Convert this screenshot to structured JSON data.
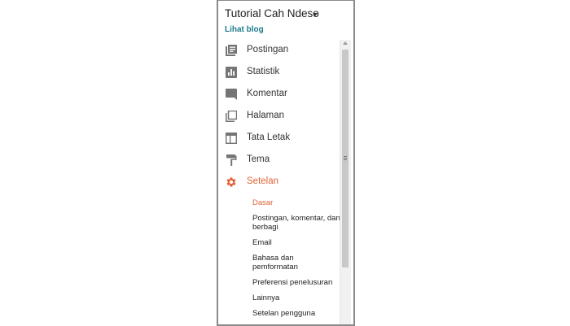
{
  "header": {
    "blog_title": "Tutorial Cah Ndeso",
    "view_blog_link": "Lihat blog"
  },
  "nav": {
    "items": [
      {
        "label": "Postingan",
        "icon": "posts-icon"
      },
      {
        "label": "Statistik",
        "icon": "stats-icon"
      },
      {
        "label": "Komentar",
        "icon": "comment-icon"
      },
      {
        "label": "Halaman",
        "icon": "pages-icon"
      },
      {
        "label": "Tata Letak",
        "icon": "layout-icon"
      },
      {
        "label": "Tema",
        "icon": "theme-paint-roller-icon"
      },
      {
        "label": "Setelan",
        "icon": "settings-gear-icon",
        "active": true
      }
    ],
    "settings_subitems": [
      {
        "label": "Dasar",
        "active": true
      },
      {
        "label": "Postingan, komentar, dan berbagi"
      },
      {
        "label": "Email"
      },
      {
        "label": "Bahasa dan pemformatan"
      },
      {
        "label": "Preferensi penelusuran"
      },
      {
        "label": "Lainnya"
      },
      {
        "label": "Setelan pengguna"
      }
    ]
  },
  "colors": {
    "accent": "#e0643a",
    "link": "#1f7a8c",
    "icon_gray": "#757575"
  }
}
